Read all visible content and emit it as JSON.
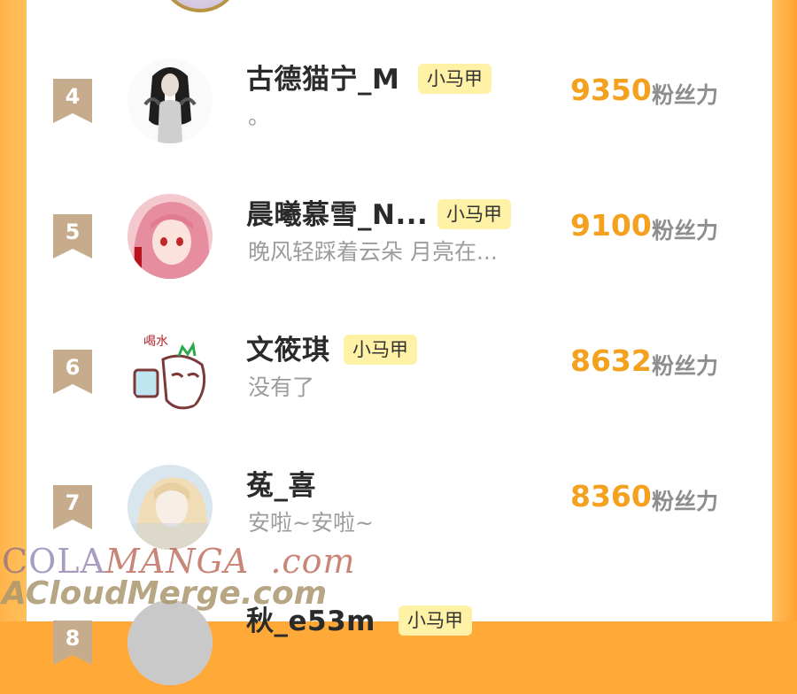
{
  "colors": {
    "background": "#ffa938",
    "panel": "#ffffff",
    "rank_badge": "#c6ab8d",
    "score": "#f3a11e",
    "tag_bg": "#fff1a6"
  },
  "leaderboard": {
    "rows": [
      {
        "rank": "4",
        "name": "古德猫宁_M",
        "tag": "小马甲",
        "signature": "。",
        "score": "9350",
        "unit": "粉丝力",
        "avatar_icon": "long-hair-girl-avatar"
      },
      {
        "rank": "5",
        "name": "晨曦慕雪_N...",
        "tag": "小马甲",
        "signature": "晚风轻踩着云朵 月亮在...",
        "score": "9100",
        "unit": "粉丝力",
        "avatar_icon": "pink-hair-girl-avatar"
      },
      {
        "rank": "6",
        "name": "文筱琪",
        "tag": "小马甲",
        "signature": "没有了",
        "score": "8632",
        "unit": "粉丝力",
        "avatar_icon": "cartoon-drink-avatar"
      },
      {
        "rank": "7",
        "name": "菟_喜",
        "tag": "",
        "signature": "安啦~安啦~",
        "score": "8360",
        "unit": "粉丝力",
        "avatar_icon": "blonde-girl-avatar"
      },
      {
        "rank": "8",
        "name": "秋_e53m",
        "tag": "小马甲",
        "signature": "",
        "score": "",
        "unit": "",
        "avatar_icon": "partial-avatar"
      }
    ]
  },
  "watermark": {
    "line1_part1": "COLA",
    "line1_part2": "MANGA",
    "line1_part3": ".com",
    "line2": "ACloudMerge.com"
  }
}
